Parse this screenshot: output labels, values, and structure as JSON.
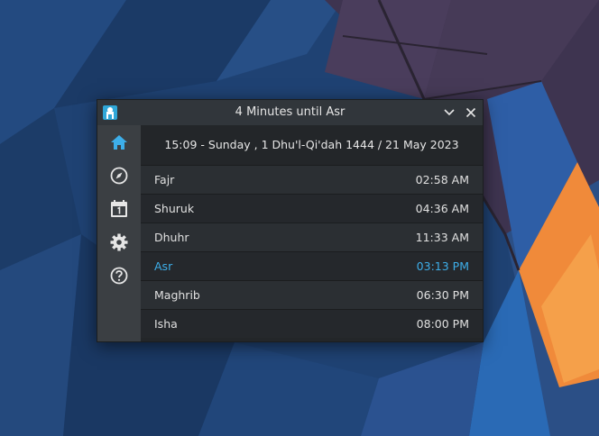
{
  "window": {
    "title": "4 Minutes until Asr",
    "app_icon": "prayer-app-icon",
    "buttons": {
      "minimize": "chevron-down-icon",
      "close": "close-icon"
    }
  },
  "sidebar": {
    "items": [
      {
        "icon": "home-icon",
        "active": true
      },
      {
        "icon": "compass-icon",
        "active": false
      },
      {
        "icon": "calendar-icon",
        "active": false
      },
      {
        "icon": "gear-icon",
        "active": false
      },
      {
        "icon": "help-icon",
        "active": false
      }
    ]
  },
  "main": {
    "date_line": "15:09 - Sunday , 1 Dhu'l-Qi'dah 1444 / 21 May 2023",
    "prayers": [
      {
        "name": "Fajr",
        "time": "02:58 AM",
        "current": false
      },
      {
        "name": "Shuruk",
        "time": "04:36 AM",
        "current": false
      },
      {
        "name": "Dhuhr",
        "time": "11:33 AM",
        "current": false
      },
      {
        "name": "Asr",
        "time": "03:13 PM",
        "current": true
      },
      {
        "name": "Maghrib",
        "time": "06:30 PM",
        "current": false
      },
      {
        "name": "Isha",
        "time": "08:00 PM",
        "current": false
      }
    ]
  },
  "colors": {
    "accent": "#3daee9",
    "text": "#e0e0e0",
    "window_bg": "#232629",
    "sidebar_bg": "#3b3f43"
  }
}
